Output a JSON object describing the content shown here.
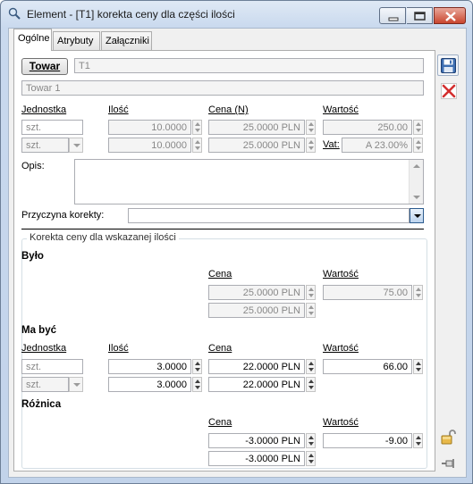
{
  "window": {
    "title": "Element - [T1] korekta ceny dla części ilości"
  },
  "tabs": [
    {
      "label": "Ogólne",
      "active": true
    },
    {
      "label": "Atrybuty",
      "active": false
    },
    {
      "label": "Załączniki",
      "active": false
    }
  ],
  "towar": {
    "button_label": "Towar",
    "code": "T1",
    "name": "Towar 1"
  },
  "headers": {
    "jednostka": "Jednostka",
    "ilosc": "Ilość",
    "cena_n": "Cena (N)",
    "wartosc": "Wartość"
  },
  "main_row1": {
    "unit": "szt.",
    "qty": "10.0000",
    "price": "25.0000 PLN",
    "value": "250.00"
  },
  "main_row2": {
    "unit": "szt.",
    "qty": "10.0000",
    "price": "25.0000 PLN",
    "vat_label": "Vat:",
    "vat": "A 23.00%"
  },
  "opis": {
    "label": "Opis:",
    "value": ""
  },
  "przyczyna": {
    "label": "Przyczyna korekty:",
    "value": ""
  },
  "korekta": {
    "group_title": "Korekta ceny dla wskazanej ilości",
    "bylo": {
      "title": "Było",
      "cena_label": "Cena",
      "wartosc_label": "Wartość",
      "price1": "25.0000 PLN",
      "value": "75.00",
      "price2": "25.0000 PLN"
    },
    "ma_byc": {
      "title": "Ma być",
      "jednostka_label": "Jednostka",
      "ilosc_label": "Ilość",
      "cena_label": "Cena",
      "wartosc_label": "Wartość",
      "unit1": "szt.",
      "qty1": "3.0000",
      "price1": "22.0000 PLN",
      "value": "66.00",
      "unit2": "szt.",
      "qty2": "3.0000",
      "price2": "22.0000 PLN"
    },
    "roznica": {
      "title": "Różnica",
      "cena_label": "Cena",
      "wartosc_label": "Wartość",
      "price1": "-3.0000 PLN",
      "value": "-9.00",
      "price2": "-3.0000 PLN"
    }
  },
  "toolbar": {
    "save_icon": "floppy-disk-icon",
    "cancel_icon": "red-x-icon",
    "lock_icon": "padlock-icon",
    "pin_icon": "pin-icon"
  }
}
